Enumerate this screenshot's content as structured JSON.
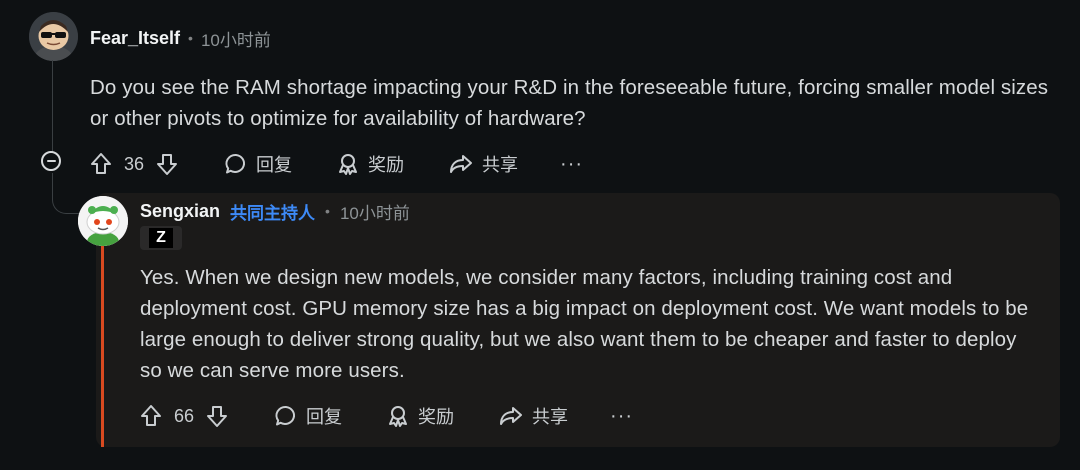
{
  "parent_comment": {
    "username": "Fear_Itself",
    "separator": "•",
    "time": "10小时前",
    "body": "Do you see the RAM shortage impacting your R&D in the foreseeable future, forcing smaller model sizes or other pivots to optimize for availability of hardware?",
    "actions": {
      "vote_count": "36",
      "reply_label": "回复",
      "award_label": "奖励",
      "share_label": "共享",
      "more_label": "···"
    }
  },
  "reply_comment": {
    "username": "Sengxian",
    "flair": "共同主持人",
    "separator": "•",
    "time": "10小时前",
    "brand_flair_text": "Z",
    "body": "Yes. When we design new models, we consider many factors, including training cost and deployment cost. GPU memory size has a big impact on deployment cost. We want models to be large enough to deliver strong quality, but we also want them to be cheaper and faster to deploy so we can serve more users.",
    "actions": {
      "vote_count": "66",
      "reply_label": "回复",
      "award_label": "奖励",
      "share_label": "共享",
      "more_label": "···"
    }
  },
  "colors": {
    "background": "#0e1113",
    "card": "#1b1a19",
    "accent_red": "#d94a20",
    "flair_blue": "#3d8af7"
  }
}
